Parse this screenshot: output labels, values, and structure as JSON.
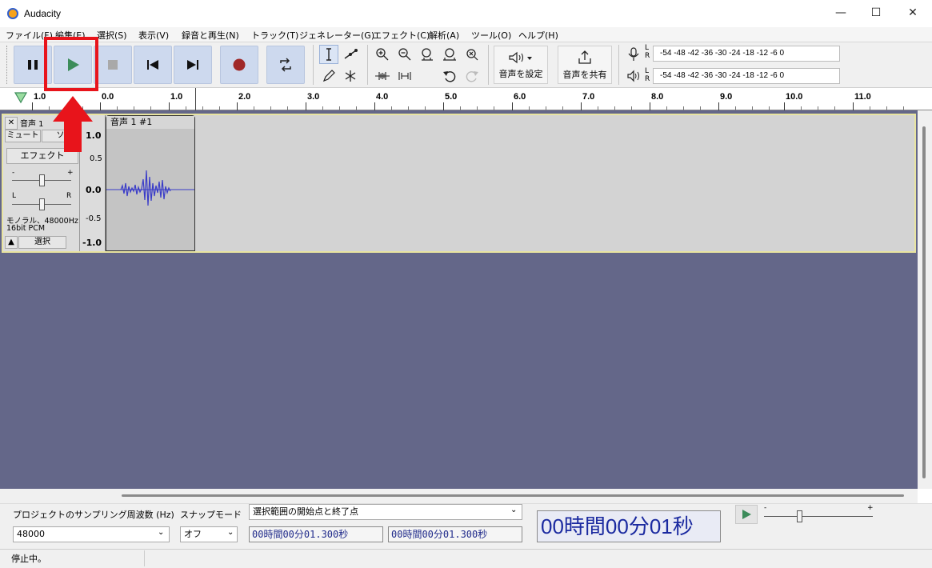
{
  "window": {
    "title": "Audacity",
    "minimize": "—",
    "maximize": "☐",
    "close": "✕"
  },
  "menu": [
    "ファイル(F)",
    "編集(E)",
    "選択(S)",
    "表示(V)",
    "録音と再生(N)",
    "トラック(T)",
    "ジェネレーター(G)",
    "エフェクト(C)",
    "解析(A)",
    "ツール(O)",
    "ヘルプ(H)"
  ],
  "toolbar": {
    "audio_setup_label": "音声を設定",
    "share_label": "音声を共有",
    "meter_scale": "-54 -48 -42 -36 -30 -24 -18 -12 -6 0",
    "meter_rec_scale": "-54 -48 -42 -36 -30 -24 -18 -12 -6 0",
    "meter_l": "L",
    "meter_r": "R"
  },
  "ruler": {
    "ticks": [
      "1.0",
      "0.0",
      "1.0",
      "2.0",
      "3.0",
      "4.0",
      "5.0",
      "6.0",
      "7.0",
      "8.0",
      "9.0",
      "10.0",
      "11.0"
    ]
  },
  "track": {
    "name": "音声 1",
    "mute": "ミュート",
    "solo": "ソ",
    "effects": "エフェクト",
    "gain_minus": "-",
    "gain_plus": "+",
    "pan_l": "L",
    "pan_r": "R",
    "format_line1": "モノラル、48000Hz",
    "format_line2": "16bit PCM",
    "select": "選択",
    "clip_name": "音声 1 #1",
    "vruler": [
      "1.0",
      "0.5",
      "0.0",
      "-0.5",
      "-1.0"
    ]
  },
  "bottom": {
    "rate_label": "プロジェクトのサンプリング周波数 (Hz)",
    "rate_value": "48000",
    "snap_label": "スナップモード",
    "snap_value": "オフ",
    "selection_mode": "選択範囲の開始点と終了点",
    "sel_start": "00時間00分01.300秒",
    "sel_end": "00時間00分01.300秒",
    "big_time": "00時間00分01秒",
    "speed_minus": "-",
    "speed_plus": "+"
  },
  "status": {
    "text": "停止中。"
  },
  "colors": {
    "accent_highlight": "#e8141b",
    "track_bg": "#646789",
    "waveform": "#3a3cc8",
    "record": "#a02828",
    "play": "#3c8c5a"
  }
}
